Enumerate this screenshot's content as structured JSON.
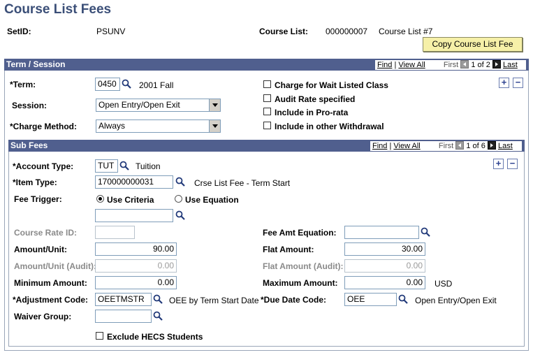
{
  "page_title": "Course List Fees",
  "setid": {
    "label": "SetID:",
    "value": "PSUNV"
  },
  "course_list": {
    "label": "Course List:",
    "value": "000000007",
    "desc": "Course List #7"
  },
  "copy_button": "Copy Course List Fee",
  "term_session": {
    "header": "Term / Session",
    "nav": {
      "find": "Find",
      "view_all": "View All",
      "first": "First",
      "count": "1 of 2",
      "last": "Last"
    },
    "term": {
      "label": "*Term:",
      "value": "0450",
      "desc": "2001 Fall"
    },
    "session": {
      "label": "Session:",
      "value": "Open Entry/Open Exit"
    },
    "charge_method": {
      "label": "*Charge Method:",
      "value": "Always"
    },
    "checkboxes": [
      {
        "label": "Charge for Wait Listed Class",
        "checked": false
      },
      {
        "label": "Audit Rate specified",
        "checked": false
      },
      {
        "label": "Include in Pro-rata",
        "checked": false
      },
      {
        "label": "Include in other Withdrawal",
        "checked": false
      }
    ]
  },
  "sub_fees": {
    "header": "Sub Fees",
    "nav": {
      "find": "Find",
      "view_all": "View All",
      "first": "First",
      "count": "1 of 6",
      "last": "Last"
    },
    "account_type": {
      "label": "*Account Type:",
      "value": "TUT",
      "desc": "Tuition"
    },
    "item_type": {
      "label": "*Item Type:",
      "value": "170000000031",
      "desc": "Crse List Fee - Term Start"
    },
    "fee_trigger": {
      "label": "Fee Trigger:",
      "option1": "Use Criteria",
      "option2": "Use Equation",
      "selected": "Use Criteria",
      "value": ""
    },
    "course_rate_id": {
      "label": "Course Rate ID:",
      "value": ""
    },
    "fee_amt_equation": {
      "label": "Fee Amt Equation:",
      "value": ""
    },
    "amount_unit": {
      "label": "Amount/Unit:",
      "value": "90.00"
    },
    "flat_amount": {
      "label": "Flat Amount:",
      "value": "30.00"
    },
    "amount_unit_audit": {
      "label": "Amount/Unit (Audit):",
      "value": "0.00"
    },
    "flat_amount_audit": {
      "label": "Flat Amount (Audit):",
      "value": "0.00"
    },
    "minimum_amount": {
      "label": "Minimum Amount:",
      "value": "0.00"
    },
    "maximum_amount": {
      "label": "Maximum Amount:",
      "value": "0.00",
      "currency": "USD"
    },
    "adjustment_code": {
      "label": "*Adjustment Code:",
      "value": "OEETMSTR",
      "desc": "OEE by Term Start Date"
    },
    "due_date_code": {
      "label": "*Due Date Code:",
      "value": "OEE",
      "desc": "Open Entry/Open Exit"
    },
    "waiver_group": {
      "label": "Waiver Group:",
      "value": ""
    },
    "exclude_hecs": {
      "label": "Exclude HECS Students",
      "checked": false
    }
  },
  "colors": {
    "header_bar": "#505f8e",
    "title": "#3b4f78",
    "button_bg": "#f6f0a8"
  }
}
